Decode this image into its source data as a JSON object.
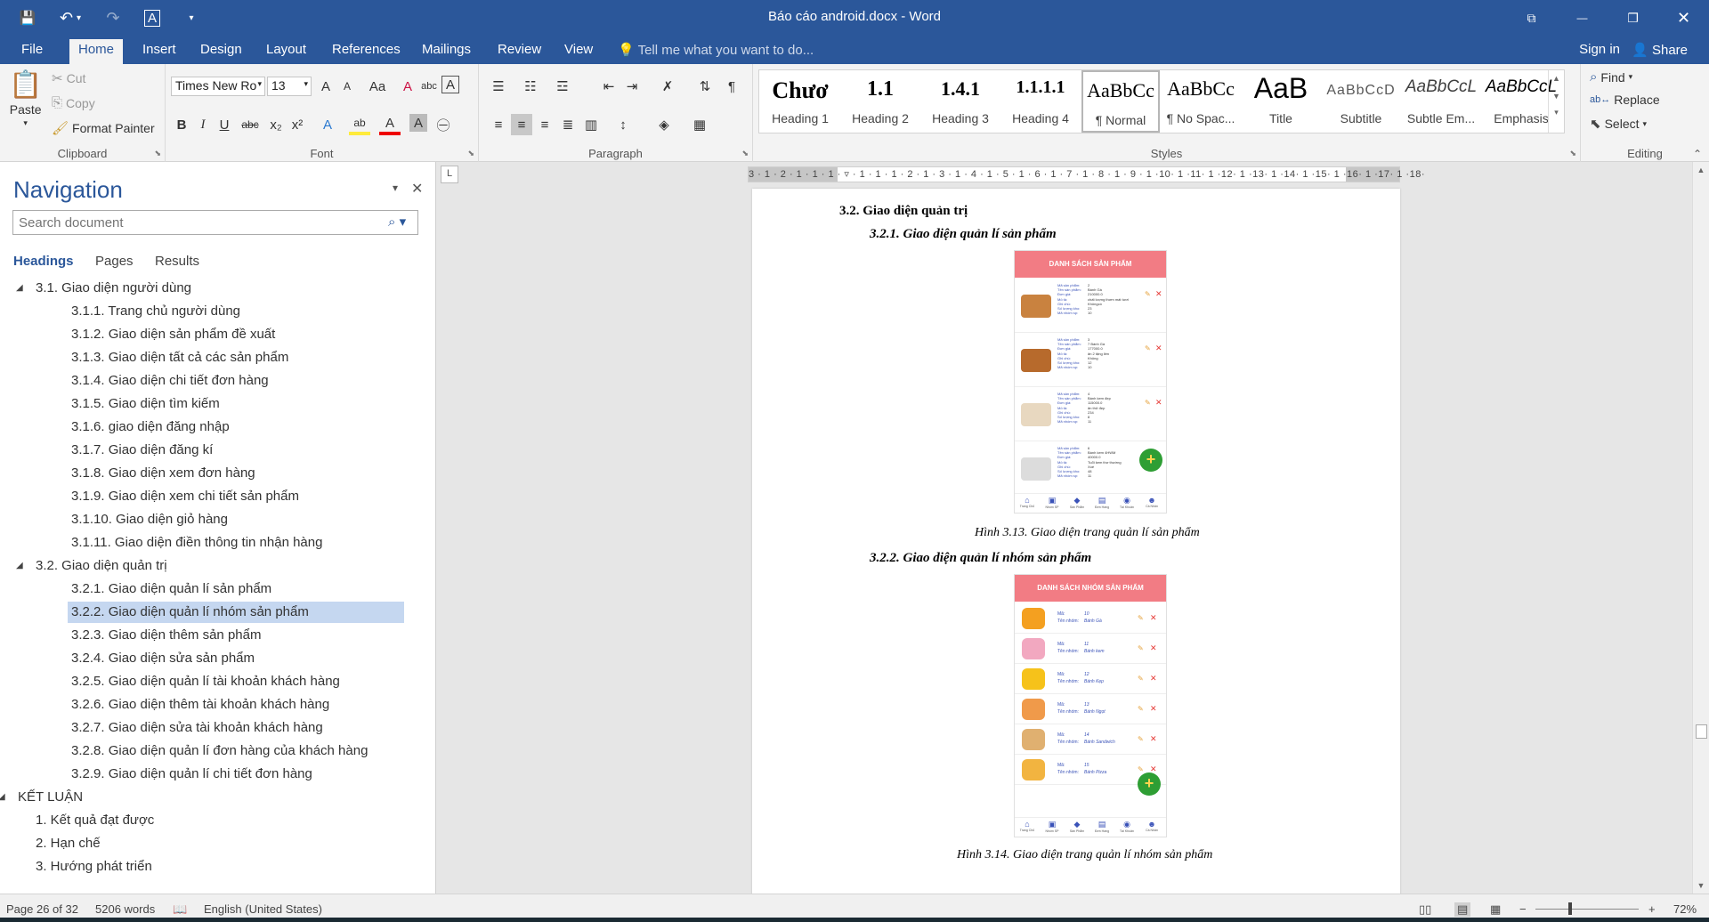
{
  "window": {
    "title": "Báo cáo android.docx - Word",
    "controls": {
      "ribbon_display": "⧉",
      "minimize": "—",
      "restore": "❐",
      "close": "✕"
    }
  },
  "qat": {
    "save": "💾",
    "undo": "↶",
    "undo_arrow": "▾",
    "redo": "↷",
    "format": "A",
    "customize": "▾"
  },
  "tabs": [
    {
      "label": "File"
    },
    {
      "label": "Home"
    },
    {
      "label": "Insert"
    },
    {
      "label": "Design"
    },
    {
      "label": "Layout"
    },
    {
      "label": "References"
    },
    {
      "label": "Mailings"
    },
    {
      "label": "Review"
    },
    {
      "label": "View"
    }
  ],
  "tellme": "Tell me what you want to do...",
  "signin": "Sign in",
  "share": "Share",
  "clipboard": {
    "label": "Clipboard",
    "paste": "Paste",
    "cut": "Cut",
    "copy": "Copy",
    "format_painter": "Format Painter"
  },
  "font": {
    "label": "Font",
    "family": "Times New Ro",
    "size": "13",
    "grow": "A",
    "shrink": "A",
    "case": "Aa",
    "clear": "A",
    "phonetic": "abc",
    "border": "A",
    "bold": "B",
    "italic": "I",
    "underline": "U",
    "strike": "abc",
    "sub": "x₂",
    "sup": "x²",
    "effects": "A",
    "highlight": "ab",
    "color": "A",
    "shade": "A",
    "enclose": "㊀"
  },
  "paragraph": {
    "label": "Paragraph"
  },
  "styles": {
    "label": "Styles",
    "items": [
      {
        "preview": "Chươ",
        "name": "Heading 1"
      },
      {
        "preview": "1.1",
        "name": "Heading 2"
      },
      {
        "preview": "1.4.1",
        "name": "Heading 3"
      },
      {
        "preview": "1.1.1.1",
        "name": "Heading 4"
      },
      {
        "preview": "AaBbCc",
        "name": "¶ Normal"
      },
      {
        "preview": "AaBbCc",
        "name": "¶ No Spac..."
      },
      {
        "preview": "AaB",
        "name": "Title"
      },
      {
        "preview": "AaBbCcD",
        "name": "Subtitle"
      },
      {
        "preview": "AaBbCcL",
        "name": "Subtle Em..."
      },
      {
        "preview": "AaBbCcL",
        "name": "Emphasis"
      }
    ]
  },
  "editing": {
    "label": "Editing",
    "find": "Find",
    "replace": "Replace",
    "select": "Select"
  },
  "navigation": {
    "title": "Navigation",
    "search_placeholder": "Search document",
    "tabs": [
      "Headings",
      "Pages",
      "Results"
    ],
    "items": [
      {
        "text": "3.1. Giao diện người dùng",
        "level": 2,
        "expanded": true
      },
      {
        "text": "3.1.1. Trang chủ người dùng",
        "level": 3
      },
      {
        "text": "3.1.2. Giao diện sản phẩm đề xuất",
        "level": 3
      },
      {
        "text": "3.1.3. Giao diện tất cả các sản phẩm",
        "level": 3
      },
      {
        "text": "3.1.4. Giao diện chi tiết đơn hàng",
        "level": 3
      },
      {
        "text": "3.1.5. Giao diện tìm kiếm",
        "level": 3
      },
      {
        "text": "3.1.6. giao diện đăng nhập",
        "level": 3
      },
      {
        "text": "3.1.7. Giao diện đăng kí",
        "level": 3
      },
      {
        "text": "3.1.8. Giao diện xem đơn hàng",
        "level": 3
      },
      {
        "text": "3.1.9. Giao diện xem chi tiết sản phẩm",
        "level": 3
      },
      {
        "text": "3.1.10. Giao diện giỏ hàng",
        "level": 3
      },
      {
        "text": "3.1.11. Giao diện điền thông tin nhận hàng",
        "level": 3
      },
      {
        "text": "3.2. Giao diện quản trị",
        "level": 2,
        "expanded": true
      },
      {
        "text": "3.2.1. Giao diện quản lí sản phẩm",
        "level": 3
      },
      {
        "text": "3.2.2. Giao diện quản lí nhóm sản phẩm",
        "level": 3,
        "selected": true
      },
      {
        "text": "3.2.3. Giao diện thêm sản phẩm",
        "level": 3
      },
      {
        "text": "3.2.4. Giao diện sửa sản phẩm",
        "level": 3
      },
      {
        "text": "3.2.5. Giao diện quản lí tài khoản khách hàng",
        "level": 3
      },
      {
        "text": "3.2.6. Giao diện thêm tài khoản khách hàng",
        "level": 3
      },
      {
        "text": "3.2.7. Giao diện sửa tài khoản khách hàng",
        "level": 3
      },
      {
        "text": "3.2.8. Giao diện quản lí đơn hàng của khách hàng",
        "level": 3
      },
      {
        "text": "3.2.9. Giao diện quản lí chi tiết đơn hàng",
        "level": 3
      },
      {
        "text": "KẾT LUẬN",
        "level": 1,
        "expanded": true
      },
      {
        "text": "1. Kết quả đạt được",
        "level": 2
      },
      {
        "text": "2. Hạn chế",
        "level": 2
      },
      {
        "text": "3. Hướng phát triển",
        "level": 2
      }
    ]
  },
  "ruler": {
    "corner": "L",
    "scale": "3 · 1 · 2 · 1 · 1 · 1 · ▿ · 1 · 1 · 1 · 2 · 1 · 3 · 1 · 4 · 1 · 5 · 1 · 6 · 1 · 7 · 1 · 8 · 1 · 9 · 1 ·10· 1 ·11· 1 ·12· 1 ·13· 1 ·14· 1 ·15· 1 ·16· 1 ·17· 1 ·18·"
  },
  "document": {
    "heading_32": "3.2. Giao diện quản trị",
    "heading_321": "3.2.1. Giao diện quản lí sản phẩm",
    "caption_313": "Hình 3.13. Giao diện trang quản lí sản phẩm",
    "heading_322": "3.2.2. Giao diện quản lí nhóm sản phẩm",
    "caption_314": "Hình 3.14. Giao diện trang quản lí nhóm sản phẩm"
  },
  "phone1": {
    "header": "DANH SÁCH SẢN PHẨM",
    "rows": [
      {
        "lines": [
          [
            "Mã sản phẩm:",
            "2"
          ],
          [
            "Tên sản phẩm:",
            "Bánh Gà"
          ],
          [
            "Đơn giá:",
            "210000.0"
          ],
          [
            "Mô tả:",
            "chất lượng thơm mát tươi"
          ],
          [
            "Ghi chú:",
            "Khôngcó"
          ],
          [
            "Số lượng kho:",
            "23"
          ],
          [
            "Mã nhóm sp:",
            "10"
          ]
        ],
        "color": "#c9823f"
      },
      {
        "lines": [
          [
            "Mã sản phẩm:",
            "3"
          ],
          [
            "Tên sản phẩm:",
            "7 Bánh Gà"
          ],
          [
            "Đơn giá:",
            "177000.0"
          ],
          [
            "Mô tả:",
            "ăn 2 tặng liền"
          ],
          [
            "Ghi chú:",
            "Không"
          ],
          [
            "Số lượng kho:",
            "12"
          ],
          [
            "Mã nhóm sp:",
            "10"
          ]
        ],
        "color": "#b76a2c"
      },
      {
        "lines": [
          [
            "Mã sản phẩm:",
            "4"
          ],
          [
            "Tên sản phẩm:",
            "Bánh kem đẹp"
          ],
          [
            "Đơn giá:",
            "115000.0"
          ],
          [
            "Mô tả:",
            "ăn thử đẹp"
          ],
          [
            "Ghi chú:",
            "234"
          ],
          [
            "Số lượng kho:",
            "8"
          ],
          [
            "Mã nhóm sp:",
            "11"
          ]
        ],
        "color": "#e8d8c0"
      },
      {
        "lines": [
          [
            "Mã sản phẩm:",
            "6"
          ],
          [
            "Tên sản phẩm:",
            "Bánh kem 4HWM"
          ],
          [
            "Đơn giá:",
            "40000.0"
          ],
          [
            "Mô tả:",
            "Tuổi kem thơ thường"
          ],
          [
            "Ghi chú:",
            "Xoé"
          ],
          [
            "Số lượng kho:",
            "48"
          ],
          [
            "Mã nhóm sp:",
            "11"
          ]
        ],
        "color": "#dcdcdc"
      }
    ]
  },
  "phone2": {
    "header": "DANH SÁCH NHÓM SẢN PHẨM",
    "rows": [
      {
        "ma": "10",
        "ten": "Bánh Gà",
        "color": "#f4a020"
      },
      {
        "ma": "11",
        "ten": "Bánh kem",
        "color": "#f2a8c0"
      },
      {
        "ma": "12",
        "ten": "Bánh Kẹp",
        "color": "#f6c21a"
      },
      {
        "ma": "13",
        "ten": "Bánh Ngọt",
        "color": "#f09a4a"
      },
      {
        "ma": "14",
        "ten": "Bánh Sandwich",
        "color": "#e0b070"
      },
      {
        "ma": "15",
        "ten": "Bánh Pizza",
        "color": "#f2b440"
      }
    ],
    "ma_label": "Mã:",
    "ten_label": "Tên nhóm:"
  },
  "bottom_nav": [
    "Trang Chủ",
    "Nhóm SP",
    "Sản Phẩm",
    "Đơn Hàng",
    "Tài Khoản",
    "Cá Nhân"
  ],
  "status": {
    "page": "Page 26 of 32",
    "words": "5206 words",
    "language": "English (United States)",
    "zoom": "72%",
    "zoom_fraction": 0.34
  }
}
